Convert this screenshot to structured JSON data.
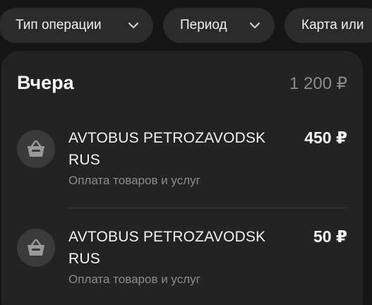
{
  "filters": [
    {
      "label": "Тип операции",
      "icon": "chevron-down-icon"
    },
    {
      "label": "Период",
      "icon": "chevron-down-icon"
    },
    {
      "label": "Карта или"
    }
  ],
  "day": {
    "title": "Вчера",
    "total": "1 200 ₽"
  },
  "transactions": [
    {
      "name": "AVTOBUS PETROZAVODSK RUS",
      "category": "Оплата товаров и услуг",
      "amount": "450 ₽",
      "icon": "shopping-basket-icon"
    },
    {
      "name": "AVTOBUS PETROZAVODSK RUS",
      "category": "Оплата товаров и услуг",
      "amount": "50 ₽",
      "icon": "shopping-basket-icon"
    }
  ],
  "colors": {
    "background": "#151515",
    "card": "#232323",
    "chip": "#2b2b2b",
    "icon_circle": "#3a3a3a",
    "muted_text": "#8c8c8c"
  }
}
